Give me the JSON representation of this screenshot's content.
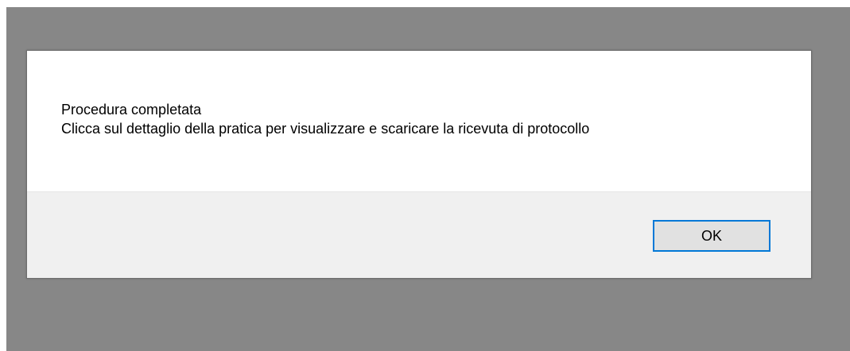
{
  "dialog": {
    "message_line1": "Procedura completata",
    "message_line2": "Clicca sul dettaglio della pratica per visualizzare e scaricare la ricevuta di protocollo",
    "ok_label": "OK"
  },
  "colors": {
    "backdrop": "#878787",
    "footer": "#f0f0f0",
    "button_border": "#0078d7",
    "button_fill": "#e1e1e1"
  }
}
